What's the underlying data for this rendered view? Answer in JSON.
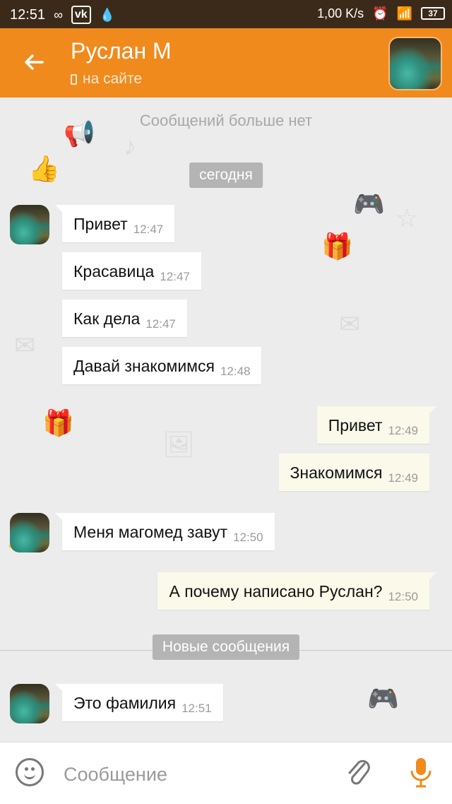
{
  "status_bar": {
    "time": "12:51",
    "speed": "1,00 K/s",
    "battery": "37",
    "colors": {
      "background": "#3b2a1a"
    }
  },
  "header": {
    "title": "Руслан М",
    "presence": "на сайте",
    "colors": {
      "background": "#f08a1c"
    }
  },
  "chat": {
    "no_more_text": "Сообщений больше нет",
    "date_label": "сегодня",
    "new_messages_label": "Новые сообщения",
    "messages": [
      {
        "dir": "in",
        "text": "Привет",
        "time": "12:47"
      },
      {
        "dir": "in",
        "text": "Красавица",
        "time": "12:47"
      },
      {
        "dir": "in",
        "text": "Как дела",
        "time": "12:47"
      },
      {
        "dir": "in",
        "text": "Давай знакомимся",
        "time": "12:48"
      },
      {
        "dir": "out",
        "text": "Привет",
        "time": "12:49"
      },
      {
        "dir": "out",
        "text": "Знакомимся",
        "time": "12:49"
      },
      {
        "dir": "in",
        "text": "Меня магомед  завут",
        "time": "12:50"
      },
      {
        "dir": "out",
        "text": "А почему написано Руслан?",
        "time": "12:50"
      },
      {
        "dir": "in",
        "text": "Это фамилия",
        "time": "12:51"
      }
    ]
  },
  "input": {
    "placeholder": "Сообщение"
  },
  "colors": {
    "accent": "#f08a1c",
    "incoming_bubble": "#ffffff",
    "outgoing_bubble": "#fbf9ea",
    "chat_background": "#ececec"
  }
}
